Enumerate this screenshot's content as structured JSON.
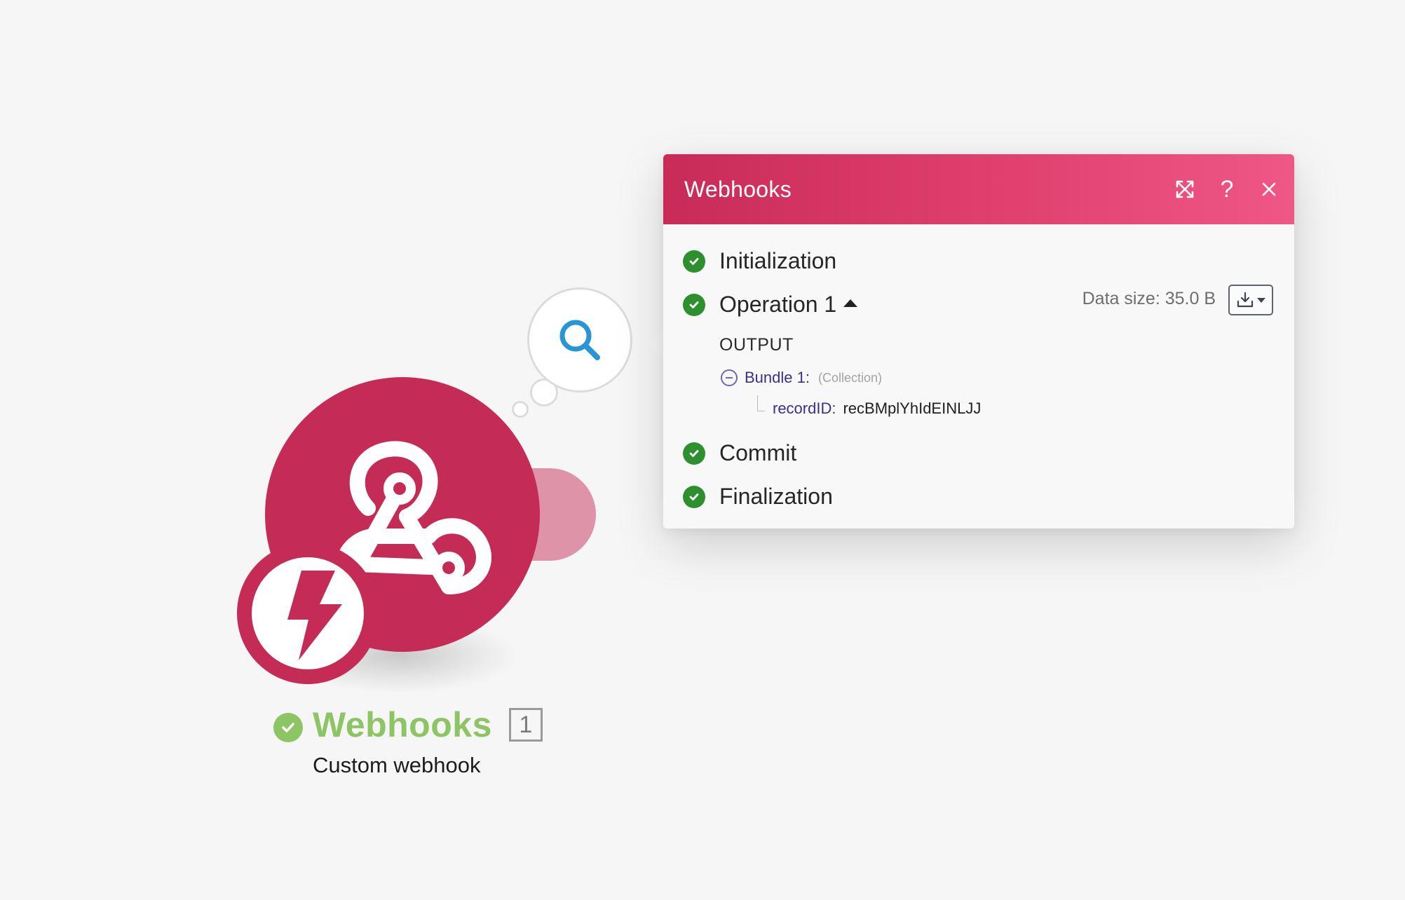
{
  "module": {
    "name": "Webhooks",
    "subtitle": "Custom webhook",
    "operation_count": "1",
    "app_icon": "webhook-icon",
    "trigger_icon": "lightning-icon",
    "inspect_icon": "search-icon",
    "brand_color": "#c42b55",
    "status_color": "#8dc464"
  },
  "panel": {
    "title": "Webhooks",
    "header_actions": {
      "expand_icon": "expand-icon",
      "help_label": "?",
      "close_icon": "close-icon"
    },
    "steps": {
      "initialization": "Initialization",
      "operation": "Operation 1",
      "commit": "Commit",
      "finalization": "Finalization"
    },
    "data_size": "Data size: 35.0 B",
    "download_icon": "download-icon",
    "output": {
      "heading": "OUTPUT",
      "bundle_label": "Bundle 1:",
      "bundle_type": "(Collection)",
      "record_key": "recordID:",
      "record_value": "recBMplYhIdEINLJJ"
    },
    "success_color": "#2e8f2e"
  }
}
